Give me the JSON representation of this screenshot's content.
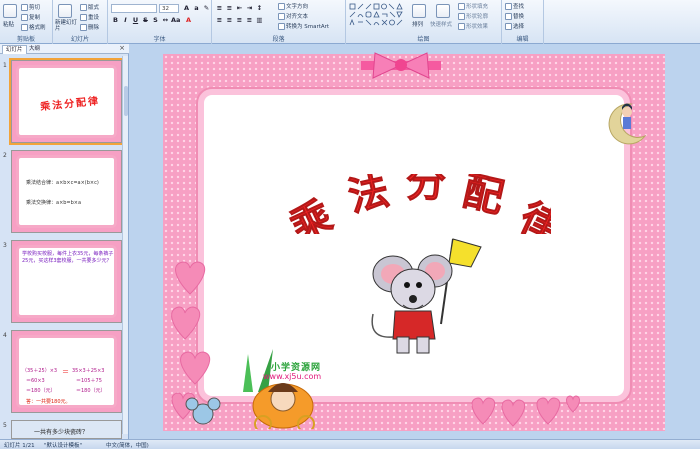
{
  "ribbon": {
    "groups": {
      "clipboard": "剪贴板",
      "slides": "幻灯片",
      "font": "字体",
      "paragraph": "段落",
      "drawing": "绘图",
      "editing": "编辑"
    },
    "paste": "粘贴",
    "cut": "剪切",
    "copy": "复制",
    "format_painter": "格式刷",
    "new_slide": "新建幻灯片",
    "layout": "版式",
    "reset": "重设",
    "delete": "删除",
    "font_size": "32",
    "text_direction": "文字方向",
    "align_text": "对齐文本",
    "smartart": "转换为 SmartArt",
    "arrange": "排列",
    "quick_styles": "快速样式",
    "shape_fill": "形状填充",
    "shape_outline": "形状轮廓",
    "shape_effects": "形状效果",
    "find": "查找",
    "replace": "替换",
    "select": "选择"
  },
  "panel": {
    "tabs": [
      "幻灯片",
      "大纲"
    ],
    "close": "×",
    "slides": [
      {
        "num": "1",
        "title": "乘法分配律"
      },
      {
        "num": "2",
        "lines": [
          "乘法结合律：a×b×c=a×(b×c)",
          "乘法交换律：a×b=b×a"
        ]
      },
      {
        "num": "3",
        "text": "学校购买校服，每件上衣35元，每条裤子25元，买这样3套校服，一共要多少元？"
      },
      {
        "num": "4",
        "eq": [
          "（35＋25）×3",
          "＝",
          "35×3＋25×3",
          "＝60×3",
          "＝105＋75",
          "＝180（元）",
          "＝180（元）"
        ],
        "ans": "答：一共要180元。"
      },
      {
        "num": "5",
        "text": "一共有多少块瓷砖？"
      }
    ]
  },
  "slide": {
    "title": "乘法分配律",
    "logo": "小学资源网",
    "url": "www.xj5u.com"
  },
  "status": {
    "slide": "幻灯片 1/21",
    "theme": "\"默认设计模板\"",
    "lang": "中文(简体，中国)"
  },
  "colors": {
    "title": "#ee2222",
    "accent": "#f7a0c4",
    "ribbon": "#d7e4f4"
  }
}
